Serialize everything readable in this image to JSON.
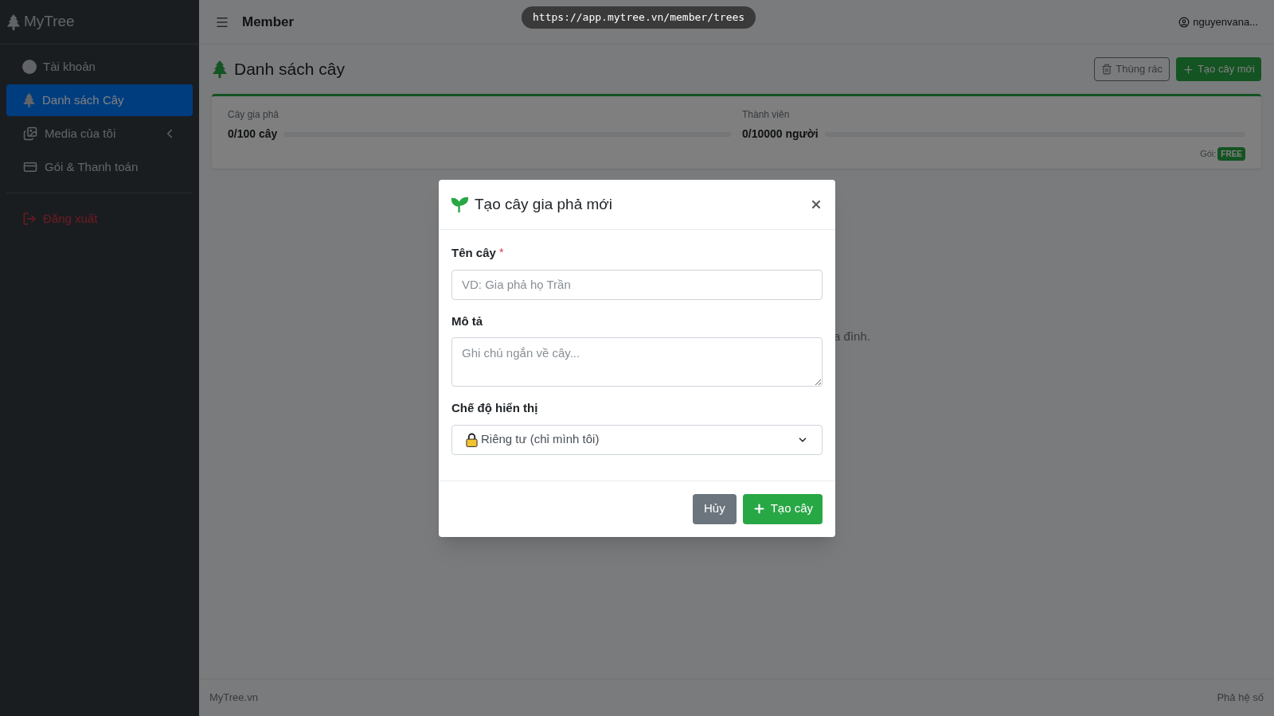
{
  "url_pill": "https://app.mytree.vn/member/trees",
  "sidebar": {
    "brand": "MyTree",
    "items": [
      {
        "label": "Tài khoản",
        "kind": "account",
        "selected": false
      },
      {
        "label": "Danh sách Cây",
        "kind": "trees",
        "selected": true
      },
      {
        "label": "Media của tôi",
        "kind": "media",
        "selected": false,
        "expanded": false
      },
      {
        "label": "Gói & Thanh toán",
        "kind": "billing",
        "selected": false
      }
    ],
    "logout": "Đăng xuất"
  },
  "header": {
    "title": "Member",
    "user": "nguyenvana..."
  },
  "page": {
    "title": "Danh sách cây",
    "buttons": [
      {
        "label": "Thùng rác",
        "kind": "trash"
      },
      {
        "label": "Tạo cây mới",
        "kind": "create"
      }
    ],
    "quota": [
      {
        "label": "Cây gia phả",
        "value": "0/100 cây",
        "level": 0
      },
      {
        "label": "Thành viên",
        "value": "0/10000 người",
        "level": 0
      }
    ],
    "plan_label": "Gói:",
    "plan": "FREE",
    "empty_text_tail": "a đình."
  },
  "modal": {
    "title": "Tạo cây gia phả mới",
    "fields": [
      {
        "kind": "input",
        "label": "Tên cây",
        "required_mark": "*",
        "placeholder": "VD: Gia phả họ Trần"
      },
      {
        "kind": "textarea",
        "label": "Mô tả",
        "placeholder": "Ghi chú ngắn về cây..."
      },
      {
        "kind": "select",
        "label": "Chế độ hiển thị",
        "value": "Riêng tư (chỉ mình tôi)"
      }
    ],
    "cancel": "Hủy",
    "submit": "Tạo cây"
  },
  "footer": {
    "left": "MyTree.vn",
    "right": "Phả hệ số"
  }
}
